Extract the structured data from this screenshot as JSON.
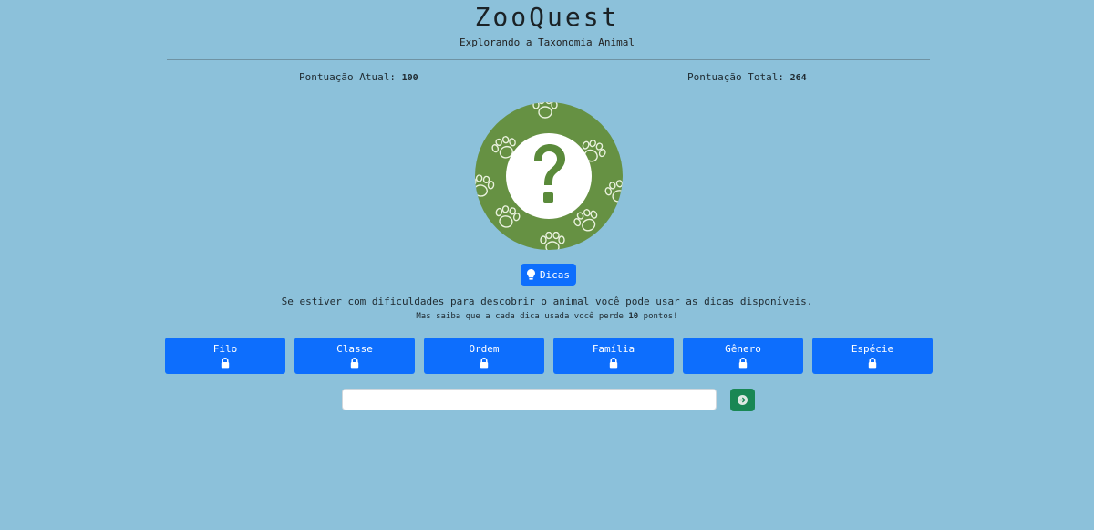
{
  "header": {
    "title": "ZooQuest",
    "subtitle": "Explorando a Taxonomia Animal"
  },
  "scores": {
    "current_label": "Pontuação Atual:",
    "current_value": "100",
    "total_label": "Pontuação Total:",
    "total_value": "264"
  },
  "animal": {
    "image_icon": "question-mark-icon",
    "background_pattern": "paw-print-pattern",
    "colors": {
      "background": "#669143",
      "center": "#ffffff"
    }
  },
  "hints": {
    "button_label": "Dicas",
    "button_icon": "lightbulb-icon",
    "message": "Se estiver com dificuldades para descobrir o animal você pode usar as dicas disponíveis.",
    "penalty_prefix": "Mas saiba que a cada dica usada você perde",
    "penalty_points": "10",
    "penalty_suffix": "pontos!"
  },
  "taxonomy": [
    {
      "label": "Filo",
      "icon": "lock-icon"
    },
    {
      "label": "Classe",
      "icon": "lock-icon"
    },
    {
      "label": "Ordem",
      "icon": "lock-icon"
    },
    {
      "label": "Família",
      "icon": "lock-icon"
    },
    {
      "label": "Gênero",
      "icon": "lock-icon"
    },
    {
      "label": "Espécie",
      "icon": "lock-icon"
    }
  ],
  "answer": {
    "value": "",
    "placeholder": "",
    "submit_icon": "arrow-right-circle-icon"
  },
  "colors": {
    "page_background": "#8cc1da",
    "primary": "#0d6efd",
    "success": "#198754"
  }
}
